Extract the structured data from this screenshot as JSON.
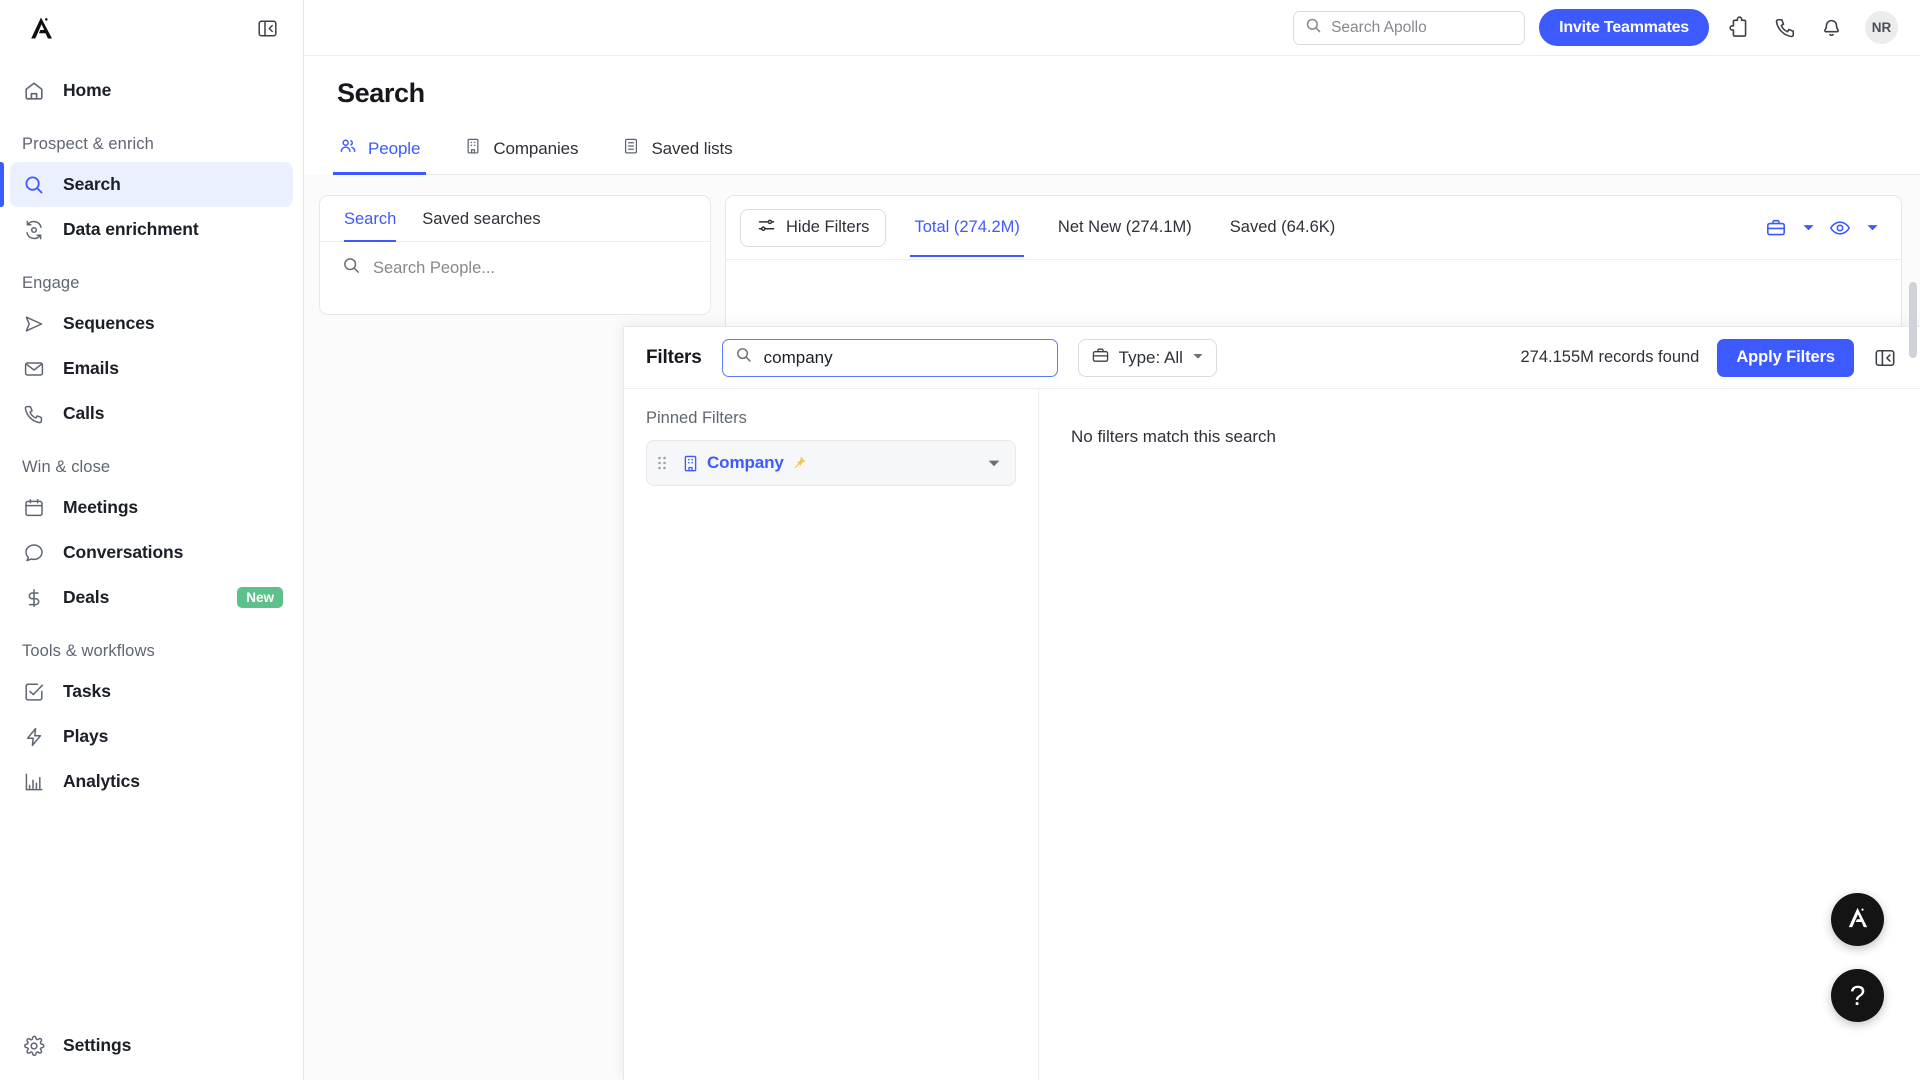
{
  "sidebar": {
    "logo_icon": "apollo-logo-icon",
    "collapse_icon": "panel-collapse-icon",
    "home": {
      "label": "Home",
      "icon": "home-icon"
    },
    "sections": [
      {
        "label": "Prospect & enrich",
        "items": [
          {
            "label": "Search",
            "icon": "search-icon",
            "active": true
          },
          {
            "label": "Data enrichment",
            "icon": "data-enrichment-icon",
            "active": false
          }
        ]
      },
      {
        "label": "Engage",
        "items": [
          {
            "label": "Sequences",
            "icon": "send-icon",
            "active": false
          },
          {
            "label": "Emails",
            "icon": "envelope-icon",
            "active": false
          },
          {
            "label": "Calls",
            "icon": "phone-icon",
            "active": false
          }
        ]
      },
      {
        "label": "Win & close",
        "items": [
          {
            "label": "Meetings",
            "icon": "calendar-icon",
            "active": false
          },
          {
            "label": "Conversations",
            "icon": "chat-bubble-icon",
            "active": false
          },
          {
            "label": "Deals",
            "icon": "dollar-icon",
            "active": false,
            "badge": "New"
          }
        ]
      },
      {
        "label": "Tools & workflows",
        "items": [
          {
            "label": "Tasks",
            "icon": "checkbox-icon",
            "active": false
          },
          {
            "label": "Plays",
            "icon": "lightning-icon",
            "active": false
          },
          {
            "label": "Analytics",
            "icon": "bar-chart-icon",
            "active": false
          }
        ]
      }
    ],
    "settings": {
      "label": "Settings",
      "icon": "gear-icon"
    }
  },
  "topbar": {
    "search_placeholder": "Search Apollo",
    "search_value": "",
    "invite_label": "Invite Teammates",
    "icons": [
      "puzzle-icon",
      "phone-icon",
      "bell-icon"
    ],
    "avatar_initials": "NR"
  },
  "page": {
    "title": "Search",
    "tabs": [
      {
        "label": "People",
        "icon": "people-icon",
        "active": true
      },
      {
        "label": "Companies",
        "icon": "building-icon",
        "active": false
      },
      {
        "label": "Saved lists",
        "icon": "list-icon",
        "active": false
      }
    ]
  },
  "search_panel": {
    "tabs": [
      {
        "label": "Search",
        "active": true
      },
      {
        "label": "Saved searches",
        "active": false
      }
    ],
    "input_placeholder": "Search People...",
    "input_value": "",
    "search_icon": "search-icon"
  },
  "results_panel": {
    "hide_filters_label": "Hide Filters",
    "hide_filters_icon": "filter-sliders-icon",
    "tabs": [
      {
        "label": "Total (274.2M)",
        "active": true
      },
      {
        "label": "Net New (274.1M)",
        "active": false
      },
      {
        "label": "Saved (64.6K)",
        "active": false
      }
    ],
    "right_icons": [
      {
        "name": "briefcase-icon"
      },
      {
        "name": "chevron-down-icon"
      },
      {
        "name": "eye-icon"
      },
      {
        "name": "chevron-down-icon"
      }
    ]
  },
  "filters_overlay": {
    "title": "Filters",
    "search_value": "company",
    "search_icon": "search-icon",
    "type_label": "Type: All",
    "type_icon": "briefcase-icon",
    "type_caret": "chevron-down-icon",
    "records_found": "274.155M records found",
    "apply_label": "Apply Filters",
    "collapse_icon": "panel-collapse-icon",
    "pinned_label": "Pinned Filters",
    "pinned_items": [
      {
        "label": "Company",
        "icon": "building-icon",
        "grip": "drag-handle-icon",
        "pin": "pin-icon",
        "caret": "chevron-down-icon"
      }
    ],
    "empty_message": "No filters match this search"
  },
  "floating": {
    "apollo_label": "",
    "help_label": "?"
  },
  "colors": {
    "accent_blue": "#3d5afe",
    "badge_green": "#5ec08a",
    "pin_yellow": "#f5c24c",
    "text_primary": "#1b1f27",
    "text_muted": "#5f6673",
    "border": "#e6e8eb"
  }
}
